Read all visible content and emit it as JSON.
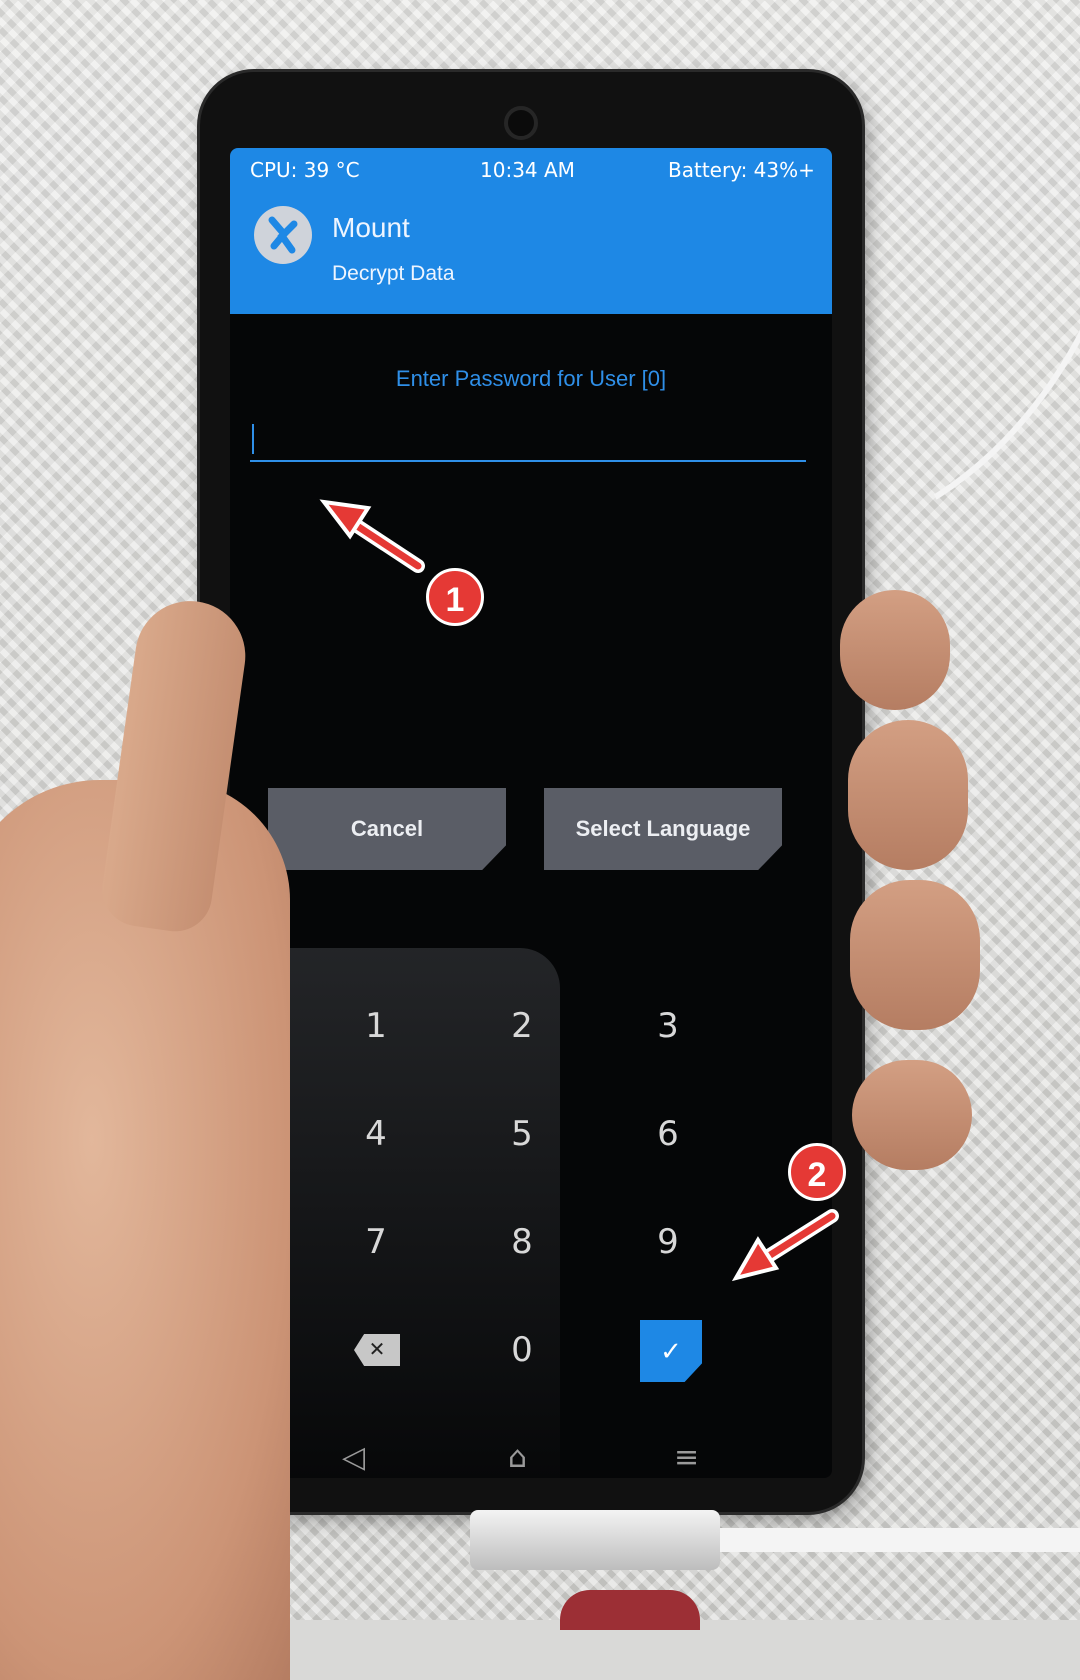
{
  "status_bar": {
    "cpu": "CPU: 39 °C",
    "time": "10:34 AM",
    "battery": "Battery: 43%+"
  },
  "header": {
    "title": "Mount",
    "subtitle": "Decrypt Data"
  },
  "password": {
    "prompt": "Enter Password for User [0]",
    "value": ""
  },
  "buttons": {
    "cancel": "Cancel",
    "select_language": "Select Language"
  },
  "keypad": {
    "keys": [
      "1",
      "2",
      "3",
      "4",
      "5",
      "6",
      "7",
      "8",
      "9",
      "0"
    ],
    "delete_symbol": "✕",
    "confirm_symbol": "✓"
  },
  "nav": {
    "back": "◁",
    "home": "⌂",
    "menu": "≡"
  },
  "annotations": [
    "1",
    "2"
  ],
  "colors": {
    "accent": "#1e88e5",
    "annotation": "#e53935",
    "screen_bg": "#050607"
  }
}
